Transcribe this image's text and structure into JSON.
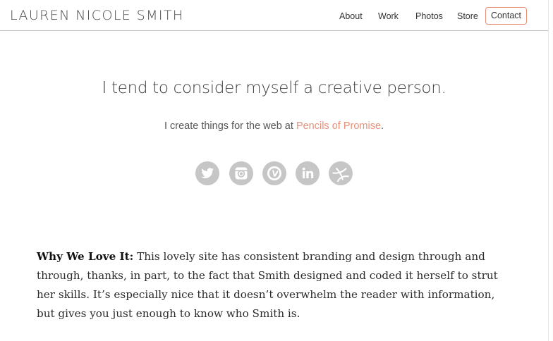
{
  "header": {
    "logo": "LAUREN NICOLE SMITH",
    "nav": {
      "about": "About",
      "work": "Work",
      "photos": "Photos",
      "store": "Store",
      "contact": "Contact"
    }
  },
  "hero": {
    "title": "I tend to consider myself a creative person.",
    "subtitle_prefix": "I create things for the web at ",
    "subtitle_link": "Pencils of Promise",
    "subtitle_suffix": "."
  },
  "social": {
    "icons": [
      "twitter-icon",
      "instagram-icon",
      "vine-icon",
      "linkedin-icon",
      "dribbble-icon"
    ]
  },
  "article": {
    "lead": "Why We Love It:",
    "line1": " This lovely site has consistent branding and design through and",
    "line2": "through, thanks, in part, to the fact that Smith designed and coded it herself to strut",
    "line3": "her skills. It’s especially nice that it doesn’t overwhelm the reader with information,",
    "line4": "but gives you just enough to know who Smith is."
  },
  "colors": {
    "accent": "#e8917a",
    "icon_gray": "#c6c6c6",
    "header_border": "#bdbdbd"
  }
}
